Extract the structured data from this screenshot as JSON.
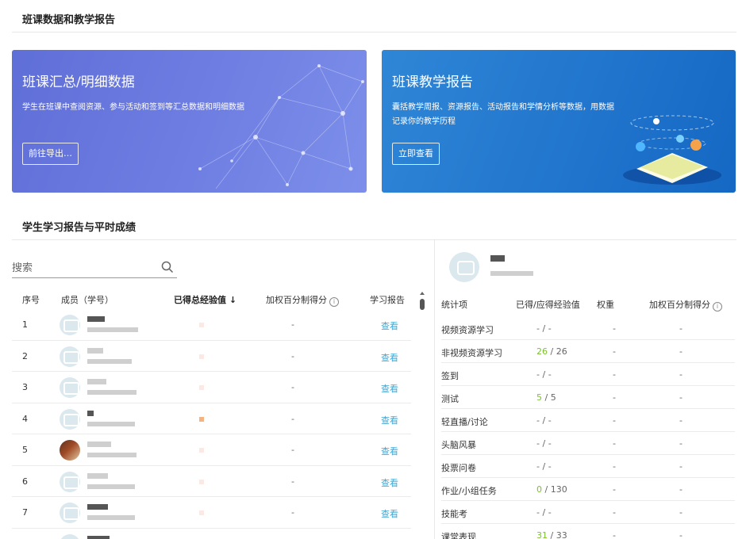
{
  "page_title": "班课数据和教学报告",
  "cards": [
    {
      "title": "班课汇总/明细数据",
      "description": "学生在班课中查阅资源、参与活动和签到等汇总数据和明细数据",
      "button": "前往导出…",
      "colors": [
        "#5f6fd8",
        "#7d8fea"
      ]
    },
    {
      "title": "班课教学报告",
      "description": "囊括教学周报、资源报告、活动报告和学情分析等数据，用数据记录你的教学历程",
      "button": "立即查看",
      "colors": [
        "#2f86d6",
        "#1568c3"
      ]
    }
  ],
  "section_title": "学生学习报告与平时成绩",
  "search": {
    "placeholder": "搜索"
  },
  "table": {
    "headers": {
      "seq": "序号",
      "member": "成员（学号）",
      "exp": "已得总经验值 ↓",
      "score": "加权百分制得分",
      "report": "学习报告"
    },
    "rows": [
      {
        "seq": "1",
        "score": "-",
        "report": "查看",
        "avatar": "default"
      },
      {
        "seq": "2",
        "score": "-",
        "report": "查看",
        "avatar": "default"
      },
      {
        "seq": "3",
        "score": "-",
        "report": "查看",
        "avatar": "default"
      },
      {
        "seq": "4",
        "score": "-",
        "report": "查看",
        "avatar": "default"
      },
      {
        "seq": "5",
        "score": "-",
        "report": "查看",
        "avatar": "photo"
      },
      {
        "seq": "6",
        "score": "-",
        "report": "查看",
        "avatar": "default"
      },
      {
        "seq": "7",
        "score": "-",
        "report": "查看",
        "avatar": "default"
      }
    ]
  },
  "stats": {
    "headers": {
      "item": "统计项",
      "exp": "已得/应得经验值",
      "weight": "权重",
      "score": "加权百分制得分"
    },
    "rows": [
      {
        "item": "视频资源学习",
        "got": "-",
        "total": "-",
        "weight": "-",
        "score": "-"
      },
      {
        "item": "非视频资源学习",
        "got": "26",
        "total": "26",
        "weight": "-",
        "score": "-"
      },
      {
        "item": "签到",
        "got": "-",
        "total": "-",
        "weight": "-",
        "score": "-"
      },
      {
        "item": "测试",
        "got": "5",
        "total": "5",
        "weight": "-",
        "score": "-"
      },
      {
        "item": "轻直播/讨论",
        "got": "-",
        "total": "-",
        "weight": "-",
        "score": "-"
      },
      {
        "item": "头脑风暴",
        "got": "-",
        "total": "-",
        "weight": "-",
        "score": "-"
      },
      {
        "item": "投票问卷",
        "got": "-",
        "total": "-",
        "weight": "-",
        "score": "-"
      },
      {
        "item": "作业/小组任务",
        "got": "0",
        "total": "130",
        "weight": "-",
        "score": "-"
      },
      {
        "item": "技能考",
        "got": "-",
        "total": "-",
        "weight": "-",
        "score": "-"
      },
      {
        "item": "课堂表现",
        "got": "31",
        "total": "33",
        "weight": "-",
        "score": "-"
      }
    ]
  },
  "colors": {
    "link": "#3aa8d8",
    "earned": "#7cc22c"
  }
}
